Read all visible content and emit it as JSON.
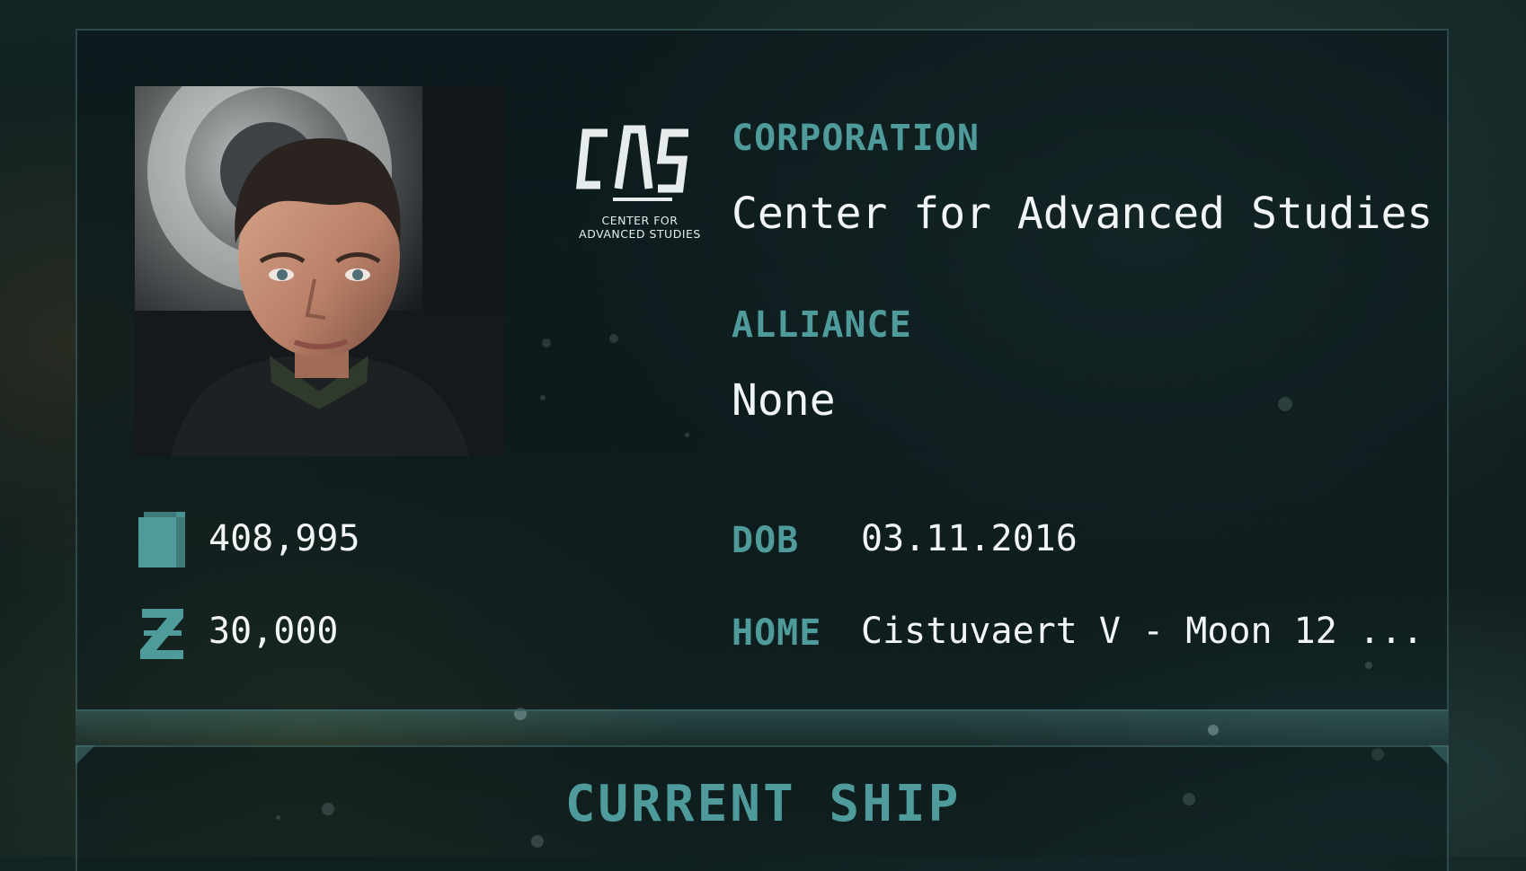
{
  "corporation": {
    "label": "CORPORATION",
    "name": "Center for Advanced Studies",
    "logo_text": "CAS",
    "logo_caption": "CENTER FOR\nADVANCED STUDIES"
  },
  "alliance": {
    "label": "ALLIANCE",
    "name": "None"
  },
  "skill_points": {
    "icon": "book-icon",
    "value": "408,995"
  },
  "isk": {
    "icon": "isk-icon",
    "value": "30,000"
  },
  "dob": {
    "label": "DOB",
    "value": "03.11.2016"
  },
  "home": {
    "label": "HOME",
    "value": "Cistuvaert V - Moon 12 ..."
  },
  "current_ship": {
    "title": "CURRENT SHIP"
  },
  "colors": {
    "accent": "#4f9a9b",
    "text": "#f2f5f5",
    "panel_border": "#466e6e"
  }
}
